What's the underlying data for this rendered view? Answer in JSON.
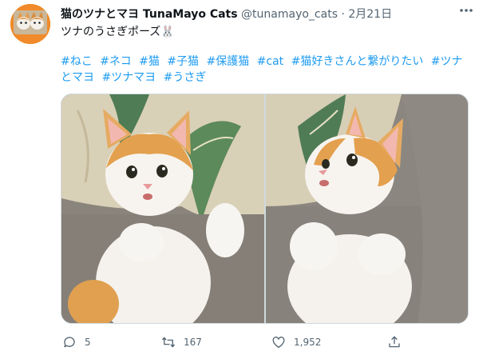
{
  "tweet": {
    "display_name": "猫のツナとマヨ TunaMayo Cats",
    "handle": "@tunamayo_cats",
    "separator": "·",
    "date": "2月21日",
    "text": "ツナのうさぎポーズ",
    "emoji": "🐰",
    "hashtags": [
      "#ねこ",
      "#ネコ",
      "#猫",
      "#子猫",
      "#保護猫",
      "#cat",
      "#猫好きさんと繋がりたい",
      "#ツナとマヨ",
      "#ツナマヨ",
      "#うさぎ"
    ],
    "media": [
      {
        "alt": "orange and white kitten on its back, paws raised, looking at camera"
      },
      {
        "alt": "orange and white kitten on its back, paws raised, head tilted"
      }
    ],
    "actions": {
      "reply_count": "5",
      "retweet_count": "167",
      "like_count": "1,952"
    },
    "icons": {
      "more": "more-icon",
      "reply": "reply-icon",
      "retweet": "retweet-icon",
      "like": "like-icon",
      "share": "share-icon"
    },
    "colors": {
      "link": "#1d9bf0",
      "secondary_text": "#536471",
      "primary_text": "#0f1419",
      "avatar_bg": "#f08a2a"
    }
  }
}
